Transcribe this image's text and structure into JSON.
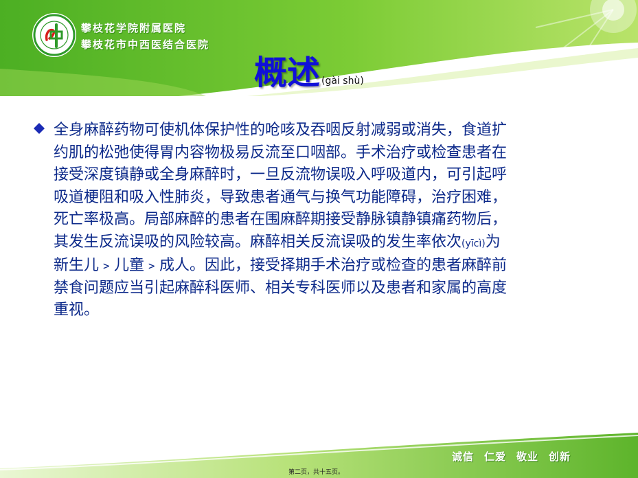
{
  "header": {
    "hospital_name_line1": "攀枝花学院附属医院",
    "hospital_name_line2": "攀枝花市中西医结合医院",
    "title": "概述",
    "title_pinyin": "(gài shù)"
  },
  "content": {
    "lines": [
      "全身麻醉药物可使机体保护性的呛咳及吞咽反射减弱或消失，食道扩",
      "约肌的松弛使得胃内容物极易反流至口咽部。手术治疗或检查患者在",
      "接受深度镇静或全身麻醉时，一旦反流物误吸入呼吸道内，可引起呼",
      "吸道梗阻和吸入性肺炎，导致患者通气与换气功能障碍，治疗困难，",
      "死亡率极高。局部麻醉的患者在围麻醉期接受静脉镇静镇痛药物后，",
      "其发生反流误吸的风险较高。麻醉相关反流误吸的发生率依次",
      "新生儿﹥儿童﹥成人。因此，接受择期手术治疗或检查的患者麻醉前",
      "禁食问题应当引起麻醉科医师、相关专科医师以及患者和家属的高度",
      "重视。"
    ],
    "line6_pinyin": "(yīcì)",
    "line6_tail": "为"
  },
  "footer": {
    "motto": [
      "诚信",
      "仁爱",
      "敬业",
      "创新"
    ],
    "page_info": "第二页，共十五页。"
  },
  "colors": {
    "green_primary": "#5cbf2a",
    "green_light": "#d6efb0",
    "title_blue": "#1010d8",
    "text_blue": "#0d2a8a",
    "bullet_blue": "#1b2bb5"
  }
}
